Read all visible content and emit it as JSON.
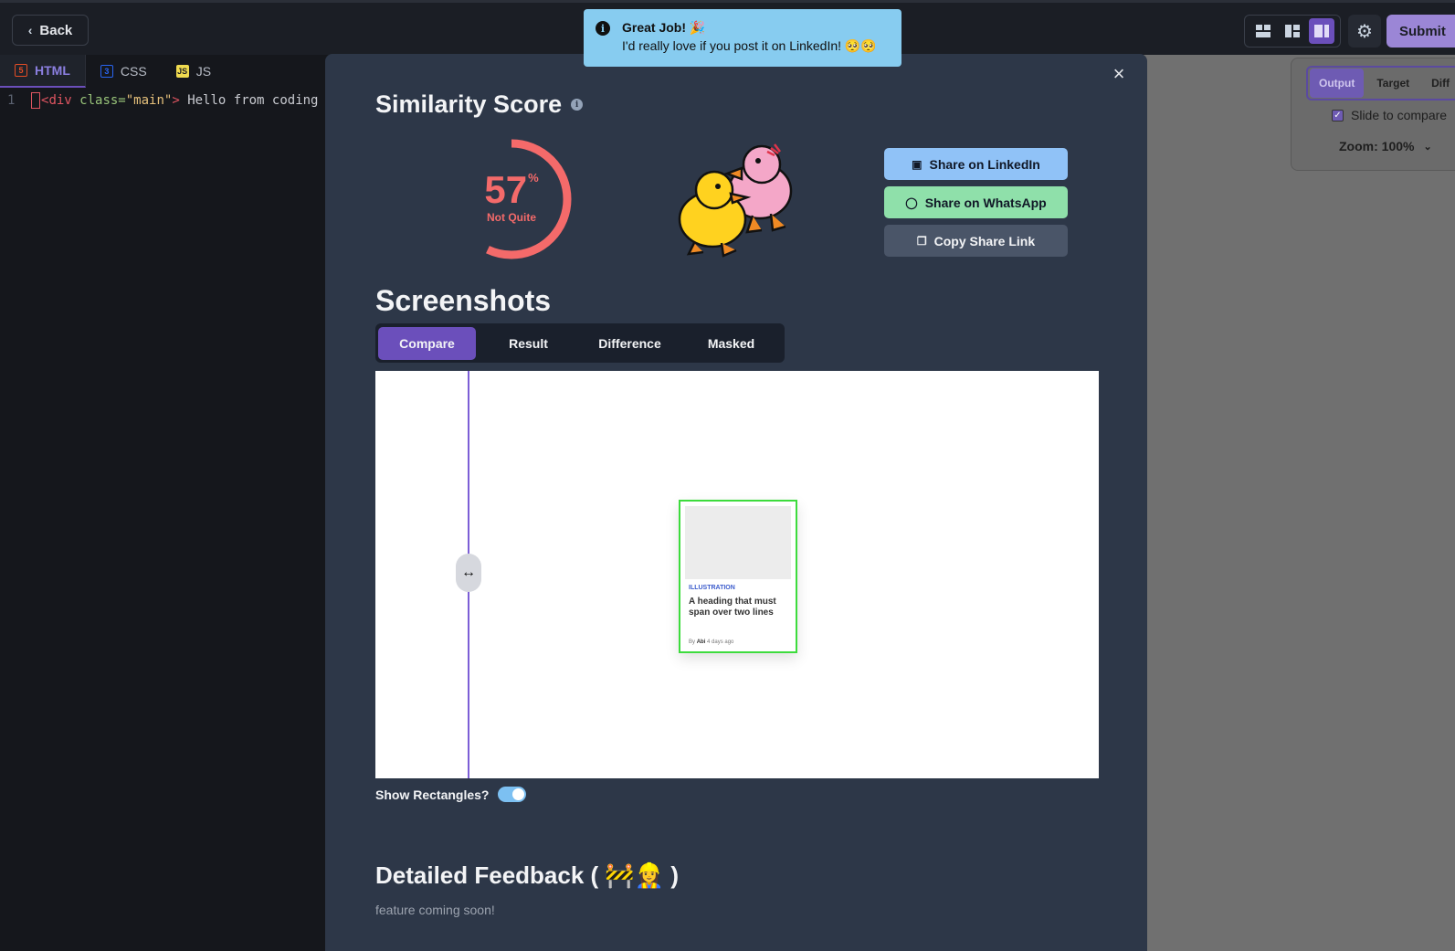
{
  "topbar": {
    "back_label": "Back",
    "submit_label": "Submit"
  },
  "editor": {
    "tabs": [
      {
        "label": "HTML",
        "icon": "html5-icon",
        "active": true
      },
      {
        "label": "CSS",
        "icon": "css3-icon",
        "active": false
      },
      {
        "label": "JS",
        "icon": "js-icon",
        "active": false
      }
    ],
    "line_number": "1",
    "code": {
      "open": "<",
      "tag": "div",
      "attr": " class=",
      "value": "\"main\"",
      "close": ">",
      "text": " Hello from coding"
    }
  },
  "output_panel": {
    "tabs": [
      "Output",
      "Target",
      "Diff"
    ],
    "active_tab": "Output",
    "slide_label": "Slide to compare",
    "slide_checked": true,
    "zoom_label": "Zoom: 100%"
  },
  "toast": {
    "title": "Great Job! 🎉",
    "message": "I'd really love if you post it on LinkedIn! 🥺🥺"
  },
  "modal": {
    "score_title": "Similarity Score",
    "score_value": "57",
    "score_unit": "%",
    "score_fraction": 0.57,
    "score_label": "Not Quite",
    "colors": {
      "score": "#f46a6a",
      "accent": "#6b4fbb",
      "linkedin": "#90c2f7",
      "whatsapp": "#8fe0aa"
    },
    "share": {
      "linkedin": "Share on LinkedIn",
      "whatsapp": "Share on WhatsApp",
      "copy": "Copy Share Link"
    },
    "screenshots_title": "Screenshots",
    "shot_tabs": [
      "Compare",
      "Result",
      "Difference",
      "Masked"
    ],
    "active_shot_tab": "Compare",
    "handle_glyph": "↔",
    "preview_card": {
      "category": "ILLUSTRATION",
      "heading": "A heading that must span over two lines",
      "by": "By",
      "author": "Abi",
      "time": "4 days ago"
    },
    "rectangles_label": "Show Rectangles?",
    "rectangles_on": true,
    "feedback_title": "Detailed Feedback ( 🚧👷‍♀️ )",
    "feedback_note": "feature coming soon!"
  }
}
